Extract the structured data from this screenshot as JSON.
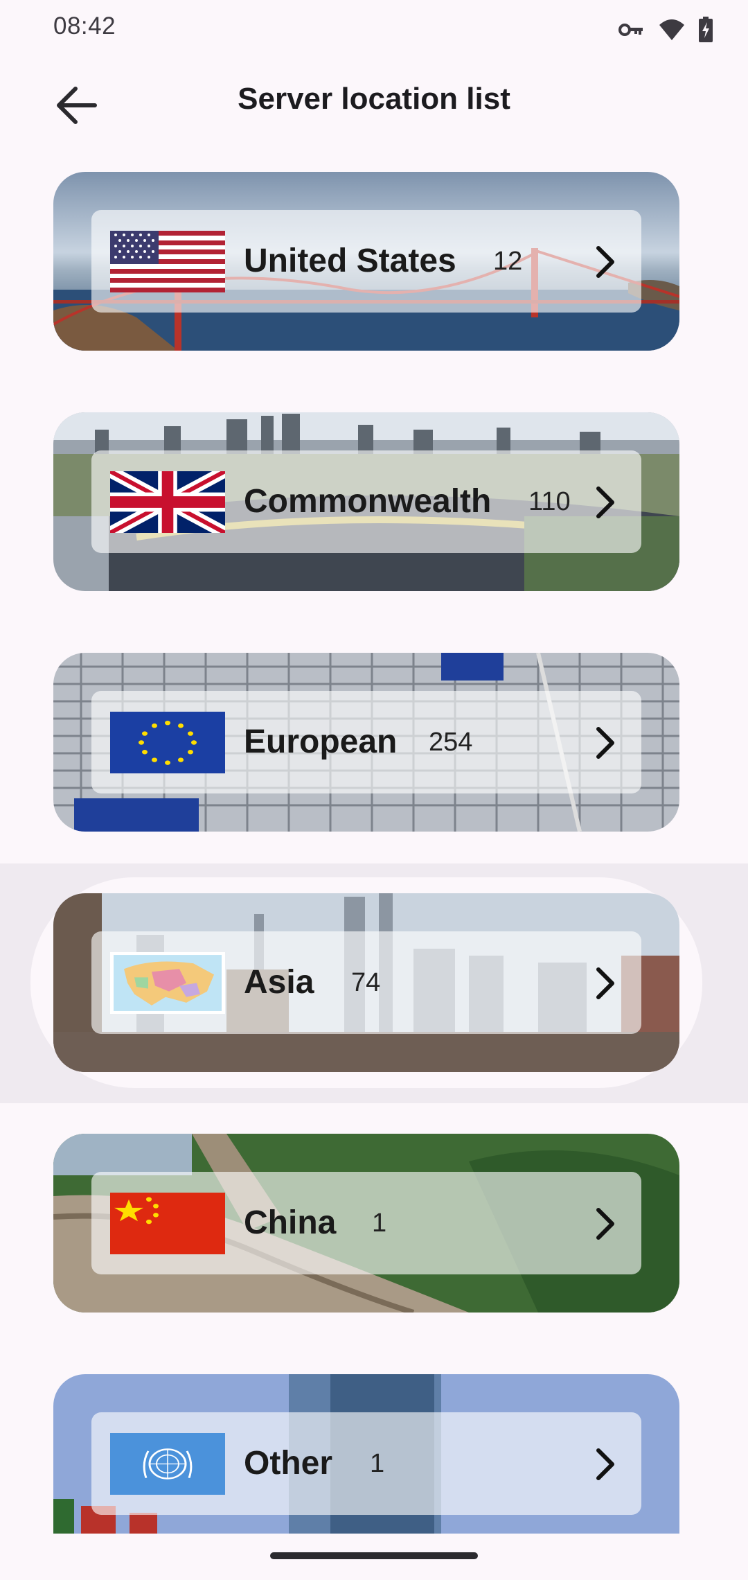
{
  "status_bar": {
    "time": "08:42",
    "icons": [
      "vpn-key-icon",
      "wifi-icon",
      "battery-charging-icon"
    ]
  },
  "app_bar": {
    "title": "Server location list",
    "back_icon": "arrow-back-icon"
  },
  "locations": [
    {
      "name": "United States",
      "count": "12"
    },
    {
      "name": "Commonwealth",
      "count": "110"
    },
    {
      "name": "European",
      "count": "254"
    },
    {
      "name": "Asia",
      "count": "74"
    },
    {
      "name": "China",
      "count": "1"
    },
    {
      "name": "Other",
      "count": "1"
    }
  ]
}
